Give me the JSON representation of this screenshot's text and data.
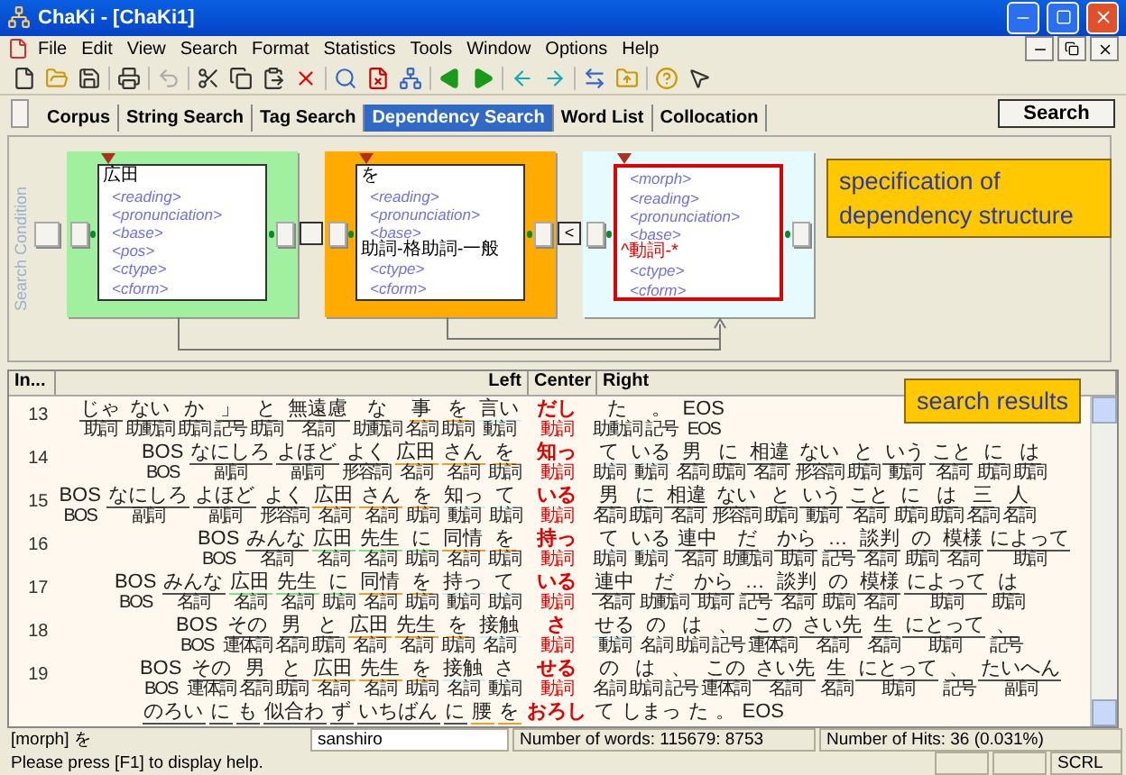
{
  "window": {
    "title": "ChaKi - [ChaKi1]"
  },
  "menu": [
    "File",
    "Edit",
    "View",
    "Search",
    "Format",
    "Statistics",
    "Tools",
    "Window",
    "Options",
    "Help"
  ],
  "tabs": [
    {
      "label": "Corpus",
      "selected": false
    },
    {
      "label": "String Search",
      "selected": false
    },
    {
      "label": "Tag Search",
      "selected": false
    },
    {
      "label": "Dependency Search",
      "selected": true
    },
    {
      "label": "Word List",
      "selected": false
    },
    {
      "label": "Collocation",
      "selected": false
    }
  ],
  "search_button": "Search",
  "condition": {
    "side_label": "Search Condition",
    "boxes": [
      {
        "color": "#a0f0a0",
        "selected": false,
        "fields": [
          {
            "text": "広田",
            "kind": "value"
          },
          {
            "text": "<reading>",
            "kind": "placeholder"
          },
          {
            "text": "<pronunciation>",
            "kind": "placeholder"
          },
          {
            "text": "<base>",
            "kind": "placeholder"
          },
          {
            "text": "<pos>",
            "kind": "placeholder"
          },
          {
            "text": "<ctype>",
            "kind": "placeholder"
          },
          {
            "text": "<cform>",
            "kind": "placeholder"
          }
        ]
      },
      {
        "color": "#ffab00",
        "selected": false,
        "fields": [
          {
            "text": "を",
            "kind": "value"
          },
          {
            "text": "<reading>",
            "kind": "placeholder"
          },
          {
            "text": "<pronunciation>",
            "kind": "placeholder"
          },
          {
            "text": "<base>",
            "kind": "placeholder"
          },
          {
            "text": "助詞-格助詞-一般",
            "kind": "value"
          },
          {
            "text": "<ctype>",
            "kind": "placeholder"
          },
          {
            "text": "<cform>",
            "kind": "placeholder"
          }
        ]
      },
      {
        "color": "#e6fbfd",
        "selected": true,
        "fields": [
          {
            "text": "<morph>",
            "kind": "placeholder"
          },
          {
            "text": "<reading>",
            "kind": "placeholder"
          },
          {
            "text": "<pronunciation>",
            "kind": "placeholder"
          },
          {
            "text": "<base>",
            "kind": "placeholder"
          },
          {
            "text": "^動詞-*",
            "kind": "regex"
          },
          {
            "text": "<ctype>",
            "kind": "placeholder"
          },
          {
            "text": "<cform>",
            "kind": "placeholder"
          }
        ]
      }
    ],
    "links": [
      {
        "kind": "blank"
      },
      {
        "kind": "label",
        "label": "<"
      }
    ],
    "callout": "specification of dependency structure"
  },
  "results": {
    "columns": [
      "In...",
      "Left",
      "Center",
      "Right"
    ],
    "callout": "search results",
    "rows": [
      {
        "index": "13",
        "left": [
          {
            "w": "じゃ",
            "pos": "助詞",
            "color": "#505050"
          },
          {
            "w": "ない",
            "pos": "助動詞",
            "color": "#505050"
          },
          {
            "w": "か",
            "pos": "助詞",
            "color": "#505050"
          },
          {
            "w": "」",
            "pos": "記号",
            "color": "#505050"
          },
          {
            "w": "と",
            "pos": "助詞",
            "color": "#505050"
          },
          {
            "w": "無遠慮",
            "pos": "名詞",
            "color": "#505050"
          },
          {
            "w": "な",
            "pos": "助動詞",
            "color": "#505050"
          },
          {
            "w": "事",
            "pos": "名詞",
            "color": "#f0a020"
          },
          {
            "w": "を",
            "pos": "助詞",
            "color": "#f0a020"
          },
          {
            "w": "言い",
            "pos": "動詞",
            "color": "#c8f0f8"
          }
        ],
        "center": {
          "w": "だし",
          "pos": "動詞"
        },
        "right": [
          {
            "w": "た",
            "pos": "助動詞"
          },
          {
            "w": "。",
            "pos": "記号"
          },
          {
            "w": "EOS",
            "pos": "EOS"
          }
        ]
      },
      {
        "index": "14",
        "left": [
          {
            "w": "BOS",
            "pos": "BOS"
          },
          {
            "w": "なにしろ",
            "pos": "副詞",
            "color": "#505050"
          },
          {
            "w": "よほど",
            "pos": "副詞",
            "color": "#505050"
          },
          {
            "w": "よく",
            "pos": "形容詞",
            "color": "#505050"
          },
          {
            "w": "広田",
            "pos": "名詞",
            "color": "#f0a020"
          },
          {
            "w": "さん",
            "pos": "名詞",
            "color": "#f0a020"
          },
          {
            "w": "を",
            "pos": "助詞",
            "color": "#f0a020"
          }
        ],
        "center": {
          "w": "知っ",
          "pos": "動詞"
        },
        "right": [
          {
            "w": "て",
            "pos": "助詞",
            "color": "#c8f0f8"
          },
          {
            "w": "いる",
            "pos": "動詞",
            "color": "#c8f0f8"
          },
          {
            "w": "男",
            "pos": "名詞",
            "color": "#505050"
          },
          {
            "w": "に",
            "pos": "助詞",
            "color": "#505050"
          },
          {
            "w": "相違",
            "pos": "名詞",
            "color": "#505050"
          },
          {
            "w": "ない",
            "pos": "形容詞",
            "color": "#505050"
          },
          {
            "w": "と",
            "pos": "助詞",
            "color": "#505050"
          },
          {
            "w": "いう",
            "pos": "動詞",
            "color": "#505050"
          },
          {
            "w": "こと",
            "pos": "名詞",
            "color": "#505050"
          },
          {
            "w": "に",
            "pos": "助詞",
            "color": "#505050"
          },
          {
            "w": "は",
            "pos": "助詞",
            "color": "#505050"
          }
        ]
      },
      {
        "index": "15",
        "left": [
          {
            "w": "BOS",
            "pos": "BOS"
          },
          {
            "w": "なにしろ",
            "pos": "副詞",
            "color": "#505050"
          },
          {
            "w": "よほど",
            "pos": "副詞",
            "color": "#505050"
          },
          {
            "w": "よく",
            "pos": "形容詞",
            "color": "#505050"
          },
          {
            "w": "広田",
            "pos": "名詞",
            "color": "#f0a020"
          },
          {
            "w": "さん",
            "pos": "名詞",
            "color": "#f0a020"
          },
          {
            "w": "を",
            "pos": "助詞",
            "color": "#f0a020"
          },
          {
            "w": "知っ",
            "pos": "動詞",
            "color": "#c8f0f8"
          },
          {
            "w": "て",
            "pos": "助詞",
            "color": "#c8f0f8"
          }
        ],
        "center": {
          "w": "いる",
          "pos": "動詞"
        },
        "right": [
          {
            "w": "男",
            "pos": "名詞",
            "color": "#505050"
          },
          {
            "w": "に",
            "pos": "助詞",
            "color": "#505050"
          },
          {
            "w": "相違",
            "pos": "名詞",
            "color": "#505050"
          },
          {
            "w": "ない",
            "pos": "形容詞",
            "color": "#505050"
          },
          {
            "w": "と",
            "pos": "助詞",
            "color": "#505050"
          },
          {
            "w": "いう",
            "pos": "動詞",
            "color": "#505050"
          },
          {
            "w": "こと",
            "pos": "名詞",
            "color": "#505050"
          },
          {
            "w": "に",
            "pos": "助詞",
            "color": "#505050"
          },
          {
            "w": "は",
            "pos": "助詞",
            "color": "#505050"
          },
          {
            "w": "三",
            "pos": "名詞",
            "color": "#505050"
          },
          {
            "w": "人",
            "pos": "名詞",
            "color": "#505050"
          }
        ]
      },
      {
        "index": "16",
        "left": [
          {
            "w": "BOS",
            "pos": "BOS"
          },
          {
            "w": "みんな",
            "pos": "名詞",
            "color": "#505050"
          },
          {
            "w": "広田",
            "pos": "名詞",
            "color": "#80e080"
          },
          {
            "w": "先生",
            "pos": "名詞",
            "color": "#80e080"
          },
          {
            "w": "に",
            "pos": "助詞",
            "color": "#80e080"
          },
          {
            "w": "同情",
            "pos": "名詞",
            "color": "#f0a020"
          },
          {
            "w": "を",
            "pos": "助詞",
            "color": "#f0a020"
          }
        ],
        "center": {
          "w": "持っ",
          "pos": "動詞"
        },
        "right": [
          {
            "w": "て",
            "pos": "助詞",
            "color": "#c8f0f8"
          },
          {
            "w": "いる",
            "pos": "動詞",
            "color": "#c8f0f8"
          },
          {
            "w": "連中",
            "pos": "名詞",
            "color": "#505050"
          },
          {
            "w": "だ",
            "pos": "助動詞",
            "color": "#505050"
          },
          {
            "w": "から",
            "pos": "助詞",
            "color": "#505050"
          },
          {
            "w": "…",
            "pos": "記号",
            "color": "#505050"
          },
          {
            "w": "談判",
            "pos": "名詞",
            "color": "#505050"
          },
          {
            "w": "の",
            "pos": "助詞",
            "color": "#505050"
          },
          {
            "w": "模様",
            "pos": "名詞",
            "color": "#505050"
          },
          {
            "w": "によって",
            "pos": "助詞",
            "color": "#505050"
          }
        ]
      },
      {
        "index": "17",
        "left": [
          {
            "w": "BOS",
            "pos": "BOS"
          },
          {
            "w": "みんな",
            "pos": "名詞",
            "color": "#505050"
          },
          {
            "w": "広田",
            "pos": "名詞",
            "color": "#80e080"
          },
          {
            "w": "先生",
            "pos": "名詞",
            "color": "#80e080"
          },
          {
            "w": "に",
            "pos": "助詞",
            "color": "#80e080"
          },
          {
            "w": "同情",
            "pos": "名詞",
            "color": "#f0a020"
          },
          {
            "w": "を",
            "pos": "助詞",
            "color": "#f0a020"
          },
          {
            "w": "持っ",
            "pos": "動詞",
            "color": "#c8f0f8"
          },
          {
            "w": "て",
            "pos": "助詞",
            "color": "#c8f0f8"
          }
        ],
        "center": {
          "w": "いる",
          "pos": "動詞"
        },
        "right": [
          {
            "w": "連中",
            "pos": "名詞",
            "color": "#505050"
          },
          {
            "w": "だ",
            "pos": "助動詞",
            "color": "#505050"
          },
          {
            "w": "から",
            "pos": "助詞",
            "color": "#505050"
          },
          {
            "w": "…",
            "pos": "記号",
            "color": "#505050"
          },
          {
            "w": "談判",
            "pos": "名詞",
            "color": "#505050"
          },
          {
            "w": "の",
            "pos": "助詞",
            "color": "#505050"
          },
          {
            "w": "模様",
            "pos": "名詞",
            "color": "#505050"
          },
          {
            "w": "によって",
            "pos": "助詞",
            "color": "#505050"
          },
          {
            "w": "は",
            "pos": "助詞",
            "color": "#505050"
          }
        ]
      },
      {
        "index": "18",
        "left": [
          {
            "w": "BOS",
            "pos": "BOS"
          },
          {
            "w": "その",
            "pos": "連体詞",
            "color": "#505050"
          },
          {
            "w": "男",
            "pos": "名詞",
            "color": "#505050"
          },
          {
            "w": "と",
            "pos": "助詞",
            "color": "#505050"
          },
          {
            "w": "広田",
            "pos": "名詞",
            "color": "#f0a020"
          },
          {
            "w": "先生",
            "pos": "名詞",
            "color": "#f0a020"
          },
          {
            "w": "を",
            "pos": "助詞",
            "color": "#f0a020"
          },
          {
            "w": "接触",
            "pos": "名詞",
            "color": "#c8f0f8"
          }
        ],
        "center": {
          "w": "さ",
          "pos": "動詞"
        },
        "right": [
          {
            "w": "せる",
            "pos": "動詞",
            "color": "#c8f0f8"
          },
          {
            "w": "の",
            "pos": "名詞"
          },
          {
            "w": "は",
            "pos": "助詞"
          },
          {
            "w": "、",
            "pos": "記号"
          },
          {
            "w": "この",
            "pos": "連体詞",
            "color": "#505050"
          },
          {
            "w": "さい先",
            "pos": "名詞",
            "color": "#505050"
          },
          {
            "w": "生",
            "pos": "名詞",
            "color": "#505050"
          },
          {
            "w": "にとって",
            "pos": "助詞",
            "color": "#505050"
          },
          {
            "w": "、",
            "pos": "記号",
            "color": "#505050"
          }
        ]
      },
      {
        "index": "19",
        "left": [
          {
            "w": "BOS",
            "pos": "BOS"
          },
          {
            "w": "その",
            "pos": "連体詞",
            "color": "#505050"
          },
          {
            "w": "男",
            "pos": "名詞",
            "color": "#505050"
          },
          {
            "w": "と",
            "pos": "助詞",
            "color": "#505050"
          },
          {
            "w": "広田",
            "pos": "名詞",
            "color": "#f0a020"
          },
          {
            "w": "先生",
            "pos": "名詞",
            "color": "#f0a020"
          },
          {
            "w": "を",
            "pos": "助詞",
            "color": "#f0a020"
          },
          {
            "w": "接触",
            "pos": "名詞",
            "color": "#c8f0f8"
          },
          {
            "w": "さ",
            "pos": "動詞",
            "color": "#c8f0f8"
          }
        ],
        "center": {
          "w": "せる",
          "pos": "動詞"
        },
        "right": [
          {
            "w": "の",
            "pos": "名詞"
          },
          {
            "w": "は",
            "pos": "助詞"
          },
          {
            "w": "、",
            "pos": "記号"
          },
          {
            "w": "この",
            "pos": "連体詞",
            "color": "#505050"
          },
          {
            "w": "さい先",
            "pos": "名詞",
            "color": "#505050"
          },
          {
            "w": "生",
            "pos": "名詞",
            "color": "#505050"
          },
          {
            "w": "にとって",
            "pos": "助詞",
            "color": "#505050"
          },
          {
            "w": "、",
            "pos": "記号",
            "color": "#505050"
          },
          {
            "w": "たいへん",
            "pos": "副詞",
            "color": "#505050"
          }
        ]
      },
      {
        "left": [
          {
            "w": "のろい",
            "color": "#505050"
          },
          {
            "w": "に",
            "color": "#505050"
          },
          {
            "w": "も",
            "color": "#505050"
          },
          {
            "w": "似合わ",
            "color": "#505050"
          },
          {
            "w": "ず",
            "color": "#505050"
          },
          {
            "w": "いちばん",
            "color": "#505050"
          },
          {
            "w": "に",
            "color": "#505050"
          },
          {
            "w": "腰",
            "color": "#f0a020"
          },
          {
            "w": "を",
            "color": "#f0a020"
          }
        ],
        "center": {
          "w": "おろし"
        },
        "right": [
          {
            "w": "て"
          },
          {
            "w": "しまっ"
          },
          {
            "w": "た"
          },
          {
            "w": "。"
          },
          {
            "w": "EOS"
          }
        ]
      }
    ]
  },
  "status_bar": {
    "morph": "[morph] を",
    "user": "sanshiro",
    "words": "Number of words: 115679: 8753",
    "hits": "Number of Hits: 36 (0.031%)",
    "help": "Please press [F1] to display help.",
    "mode": "SCRL"
  }
}
